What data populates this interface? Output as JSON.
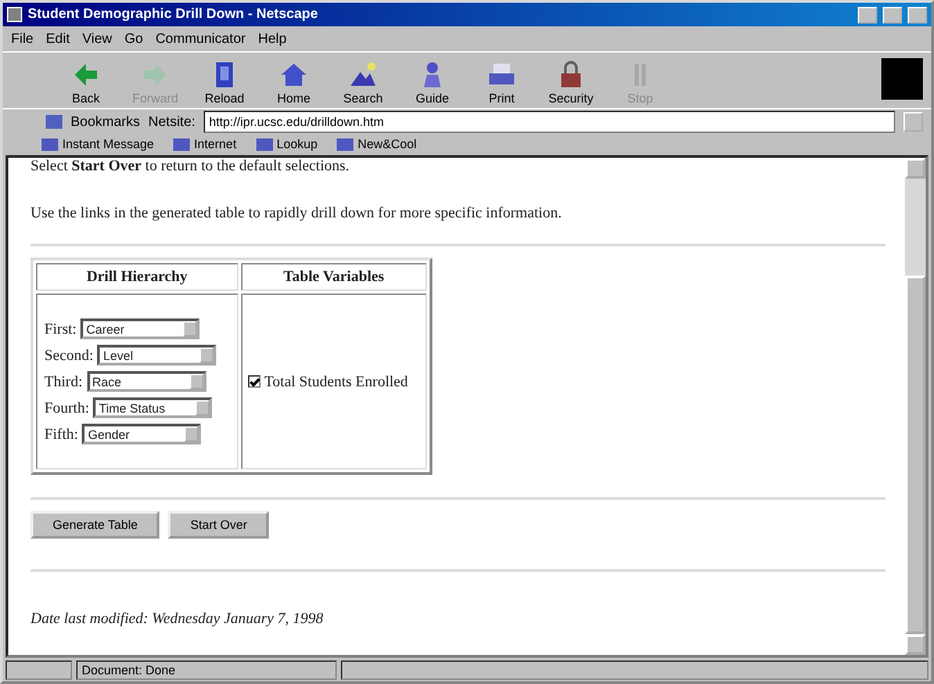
{
  "window": {
    "title": "Student Demographic Drill Down - Netscape"
  },
  "menu": [
    "File",
    "Edit",
    "View",
    "Go",
    "Communicator",
    "Help"
  ],
  "toolbar": [
    {
      "label": "Back",
      "disabled": false
    },
    {
      "label": "Forward",
      "disabled": true
    },
    {
      "label": "Reload",
      "disabled": false
    },
    {
      "label": "Home",
      "disabled": false
    },
    {
      "label": "Search",
      "disabled": false
    },
    {
      "label": "Guide",
      "disabled": false
    },
    {
      "label": "Print",
      "disabled": false
    },
    {
      "label": "Security",
      "disabled": false
    },
    {
      "label": "Stop",
      "disabled": true
    }
  ],
  "location": {
    "bookmarks": "Bookmarks",
    "label": "Netsite:",
    "value": "http://ipr.ucsc.edu/drilldown.htm"
  },
  "personal_toolbar": [
    "Instant Message",
    "Internet",
    "Lookup",
    "New&Cool"
  ],
  "content": {
    "intro": [
      "Select **Start Over** to return to the default selections.",
      "Use the links in the generated table to rapidly drill down for more specific information."
    ],
    "table": {
      "columns": [
        "Drill Hierarchy",
        "Table Variables"
      ],
      "levels": [
        {
          "label": "First:",
          "value": "Career"
        },
        {
          "label": "Second:",
          "value": "Level"
        },
        {
          "label": "Third:",
          "value": "Race"
        },
        {
          "label": "Fourth:",
          "value": "Time Status"
        },
        {
          "label": "Fifth:",
          "value": "Gender"
        }
      ],
      "variables": [
        {
          "label": "Total Students Enrolled",
          "checked": true
        }
      ]
    },
    "buttons": [
      "Generate Table",
      "Start Over"
    ],
    "footer": "Date last modified: Wednesday January 7, 1998"
  },
  "status_bar": {
    "text": "Document: Done"
  }
}
